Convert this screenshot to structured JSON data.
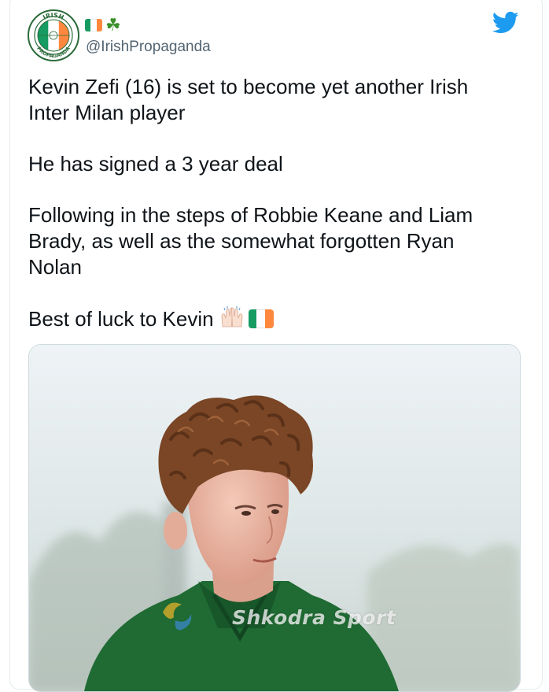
{
  "tweet": {
    "handle": "@IrishPropaganda",
    "avatar_text": {
      "top": "IRISH",
      "bottom": "PROPAGANDA"
    },
    "name_icons": [
      "ireland-flag-emoji",
      "shamrock-emoji"
    ],
    "paragraphs": [
      "Kevin Zefi (16) is set to become yet another Irish\nInter Milan player",
      "He has signed a 3 year deal",
      "Following in the steps of Robbie Keane and Liam\nBrady, as well as the somewhat forgotten Ryan\nNolan"
    ],
    "closing_line": "Best of luck to Kevin",
    "closing_emojis": [
      "raising-hands-emoji",
      "ireland-flag-emoji"
    ]
  },
  "media": {
    "watermark": "Shkodra Sport"
  },
  "colors": {
    "twitter_blue": "#1d9bf0",
    "irish_green": "#169b62",
    "irish_orange": "#ff883e",
    "text_primary": "#0f1419",
    "text_secondary": "#536471"
  }
}
